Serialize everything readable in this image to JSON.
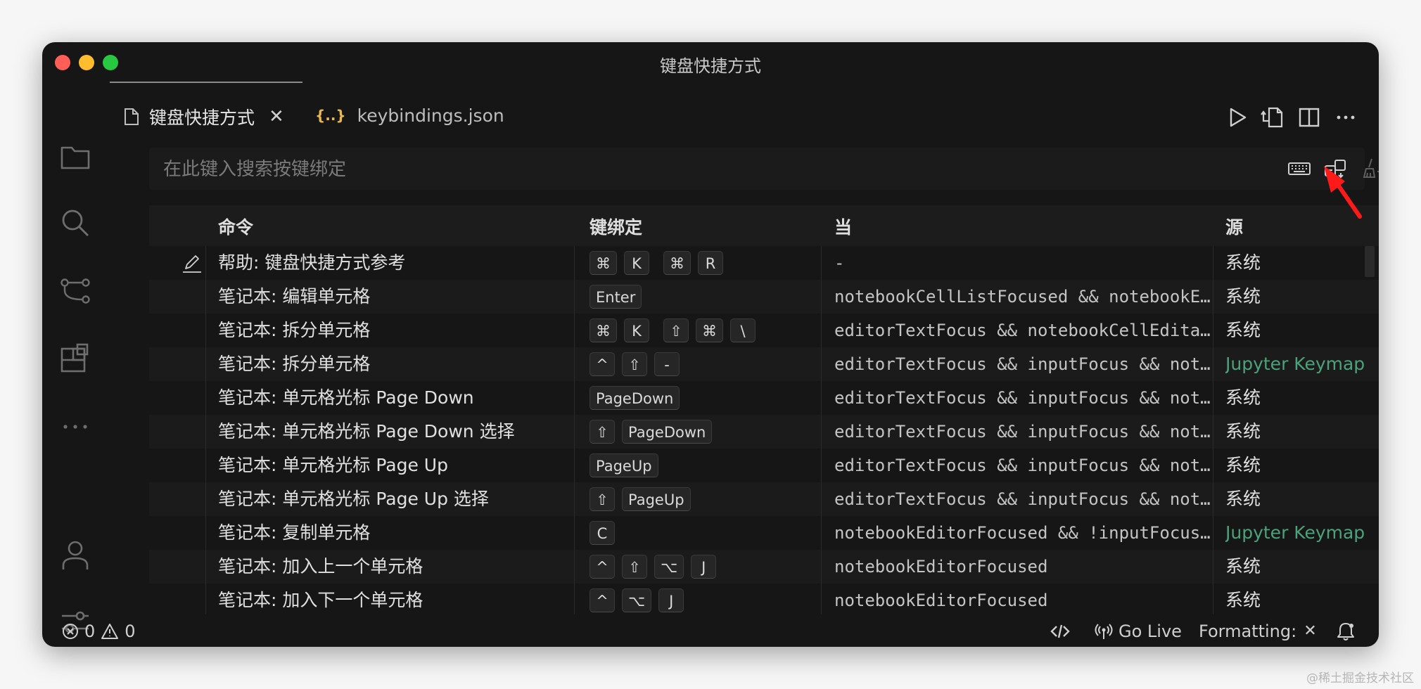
{
  "window": {
    "title": "键盘快捷方式"
  },
  "traffic_lights": {
    "close": "#ff5f57",
    "minimize": "#febc2e",
    "zoom": "#28c840"
  },
  "activity_bar": [
    {
      "icon": "files-icon"
    },
    {
      "icon": "search-icon"
    },
    {
      "icon": "source-control-icon"
    },
    {
      "icon": "extensions-icon"
    },
    {
      "icon": "more-icon"
    },
    {
      "icon": "account-icon"
    },
    {
      "icon": "settings-icon"
    }
  ],
  "tabs": [
    {
      "label": "键盘快捷方式",
      "icon": "document-icon",
      "active": true
    },
    {
      "label": "keybindings.json",
      "icon": "json-braces-icon",
      "icon_text": "{..}",
      "icon_color": "#e8b84a",
      "active": false
    }
  ],
  "toolbar_icons": [
    "run-icon",
    "open-keybindings-json-icon",
    "split-editor-icon",
    "more-actions-icon"
  ],
  "search": {
    "placeholder": "在此键入搜索按键绑定",
    "value": "",
    "actions": [
      "keyboard-icon",
      "sort-by-precedence-icon",
      "clear-input-icon"
    ]
  },
  "table": {
    "headers": {
      "command": "命令",
      "keybinding": "键绑定",
      "when": "当",
      "source": "源"
    },
    "rows": [
      {
        "command": "帮助: 键盘快捷方式参考",
        "chords": [
          [
            "⌘",
            "K"
          ],
          [
            "⌘",
            "R"
          ]
        ],
        "when": "-",
        "source": "系统",
        "edit_icon": true
      },
      {
        "command": "笔记本: 编辑单元格",
        "chords": [
          [
            "Enter"
          ]
        ],
        "when": "notebookCellListFocused && notebookEditorFocused",
        "source": "系统"
      },
      {
        "command": "笔记本: 拆分单元格",
        "chords": [
          [
            "⌘",
            "K"
          ],
          [
            "⇧",
            "⌘",
            "\\"
          ]
        ],
        "when": "editorTextFocus && notebookCellEditable",
        "source": "系统"
      },
      {
        "command": "笔记本: 拆分单元格",
        "chords": [
          [
            "^",
            "⇧",
            "-"
          ]
        ],
        "when": "editorTextFocus && inputFocus && notebookEditorFocused",
        "source": "Jupyter Keymap",
        "source_ext": true
      },
      {
        "command": "笔记本: 单元格光标 Page Down",
        "chords": [
          [
            "PageDown"
          ]
        ],
        "when": "editorTextFocus && inputFocus && notebookEditorFocused",
        "source": "系统"
      },
      {
        "command": "笔记本: 单元格光标 Page Down 选择",
        "chords": [
          [
            "⇧",
            "PageDown"
          ]
        ],
        "when": "editorTextFocus && inputFocus && notebookEditorFocused",
        "source": "系统"
      },
      {
        "command": "笔记本: 单元格光标 Page Up",
        "chords": [
          [
            "PageUp"
          ]
        ],
        "when": "editorTextFocus && inputFocus && notebookEditorFocused",
        "source": "系统"
      },
      {
        "command": "笔记本: 单元格光标 Page Up 选择",
        "chords": [
          [
            "⇧",
            "PageUp"
          ]
        ],
        "when": "editorTextFocus && inputFocus && notebookEditorFocused",
        "source": "系统"
      },
      {
        "command": "笔记本: 复制单元格",
        "chords": [
          [
            "C"
          ]
        ],
        "when": "notebookEditorFocused && !inputFocus && notebookOutputFocused",
        "source": "Jupyter Keymap",
        "source_ext": true
      },
      {
        "command": "笔记本: 加入上一个单元格",
        "chords": [
          [
            "^",
            "⇧",
            "⌥",
            "J"
          ]
        ],
        "when": "notebookEditorFocused",
        "source": "系统"
      },
      {
        "command": "笔记本: 加入下一个单元格",
        "chords": [
          [
            "^",
            "⌥",
            "J"
          ]
        ],
        "when": "notebookEditorFocused",
        "source": "系统"
      }
    ]
  },
  "statusbar": {
    "errors": "0",
    "warnings": "0",
    "go_live": "Go Live",
    "formatting": "Formatting:"
  },
  "annotation": {
    "arrow_color": "#ff1a1a"
  },
  "watermark": "@稀土掘金技术社区"
}
